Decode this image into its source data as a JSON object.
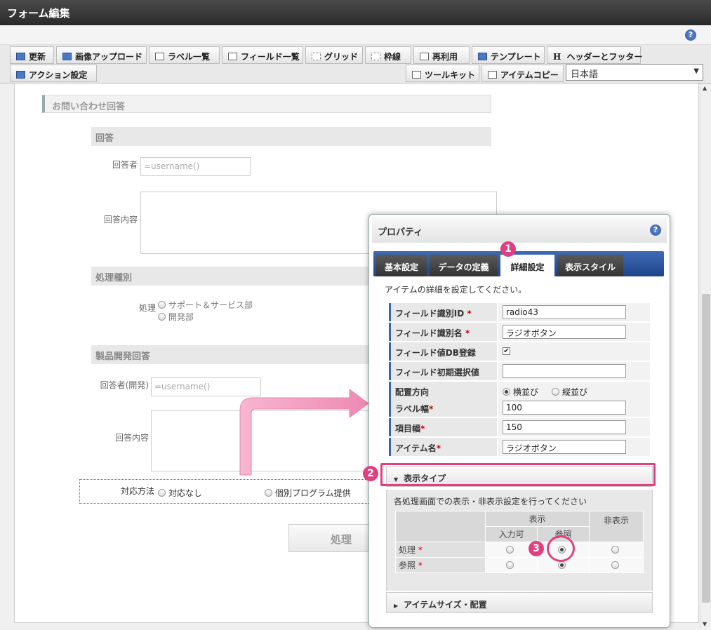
{
  "window": {
    "title": "フォーム編集"
  },
  "toolbar": {
    "row1": [
      "更新",
      "画像アップロード",
      "ラベル一覧",
      "フィールド一覧",
      "グリッド",
      "枠線",
      "再利用",
      "テンプレート",
      "ヘッダーとフッター"
    ],
    "header_glyph": "H",
    "action_settings": "アクション設定",
    "toolkit": "ツールキット",
    "item_copy": "アイテムコピー",
    "language": "日本語"
  },
  "form": {
    "heading": "お問い合わせ回答",
    "answer_section": "回答",
    "responder_label": "回答者",
    "responder_value": "=username()",
    "content_label": "回答内容",
    "processing_section": "処理種別",
    "processing_label": "処理",
    "processing_options": [
      "サポート＆サービス部",
      "開発部"
    ],
    "dev_section": "製品開発回答",
    "dev_responder_label": "回答者(開発)",
    "dev_responder_value": "=username()",
    "dev_content_label": "回答内容",
    "method_label": "対応方法",
    "method_options": [
      "対応なし",
      "個別プログラム提供"
    ],
    "process_button": "処理"
  },
  "properties": {
    "title": "プロパティ",
    "help": "?",
    "tabs": [
      "基本設定",
      "データの定義",
      "詳細設定",
      "表示スタイル"
    ],
    "active_tab": "詳細設定",
    "description": "アイテムの詳細を設定してください。",
    "fields": {
      "field_id_label": "フィールド識別ID",
      "field_id_value": "radio43",
      "field_name_label": "フィールド識別名",
      "field_name_value": "ラジオボタン",
      "db_label": "フィールド値DB登録",
      "db_checked": "✔",
      "initial_label": "フィールド初期選択値",
      "initial_value": "",
      "direction_label": "配置方向",
      "direction_options": [
        "横並び",
        "縦並び"
      ],
      "label_width_label": "ラベル幅",
      "label_width_value": "100",
      "item_width_label": "項目幅",
      "item_width_value": "150",
      "item_name_label": "アイテム名",
      "item_name_value": "ラジオボタン"
    },
    "required_mark": "*",
    "display_type": {
      "title": "表示タイプ",
      "description": "各処理画面での表示・非表示設定を行ってください",
      "col_display": "表示",
      "col_input": "入力可",
      "col_ref": "参照",
      "col_hidden": "非表示",
      "rows": [
        "処理",
        "参照"
      ]
    },
    "item_size": "アイテムサイズ・配置"
  },
  "annotations": {
    "badges": [
      "1",
      "2",
      "3"
    ],
    "color": "#e0407f"
  }
}
